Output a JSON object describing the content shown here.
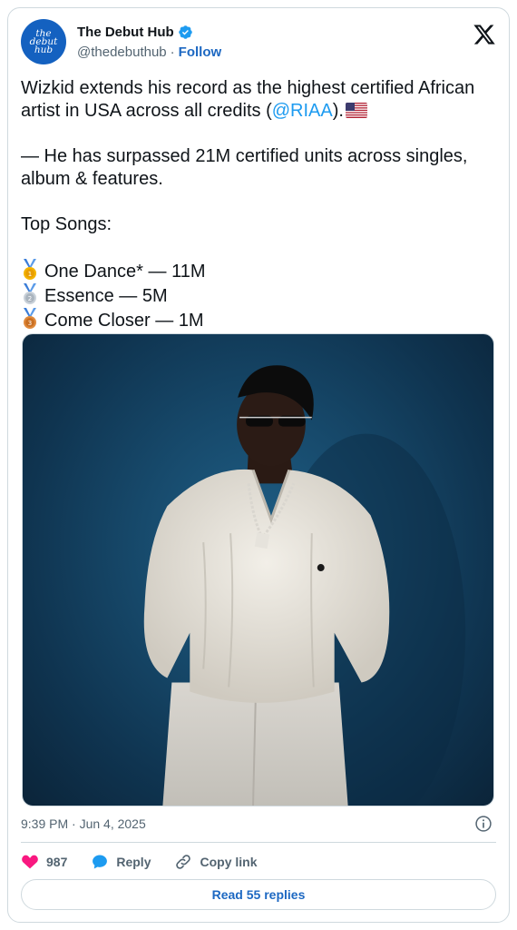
{
  "author": {
    "name": "The Debut Hub",
    "handle": "@thedebuthub",
    "separator": "·",
    "follow_label": "Follow",
    "avatar_lines": [
      "the",
      "debut",
      "hub"
    ]
  },
  "tweet": {
    "line1_a": "Wizkid extends his record as the highest certified African artist in USA across all credits (",
    "mention": "@RIAA",
    "line1_b": ").",
    "line2": "— He has surpassed 21M certified units across singles, album & features.",
    "line3": "Top Songs:",
    "songs": [
      {
        "medal": "gold-medal-icon",
        "text": "One Dance* — 11M"
      },
      {
        "medal": "silver-medal-icon",
        "text": "Essence — 5M"
      },
      {
        "medal": "bronze-medal-icon",
        "text": "Come Closer — 1M"
      }
    ]
  },
  "meta": {
    "timestamp": "9:39 PM · Jun 4, 2025"
  },
  "actions": {
    "likes": "987",
    "reply_label": "Reply",
    "copy_label": "Copy link"
  },
  "read_replies": "Read 55 replies",
  "colors": {
    "link": "#1d9bf0",
    "follow": "#1d68c2",
    "like": "#f91880",
    "reply": "#1d9bf0",
    "muted": "#536471"
  }
}
